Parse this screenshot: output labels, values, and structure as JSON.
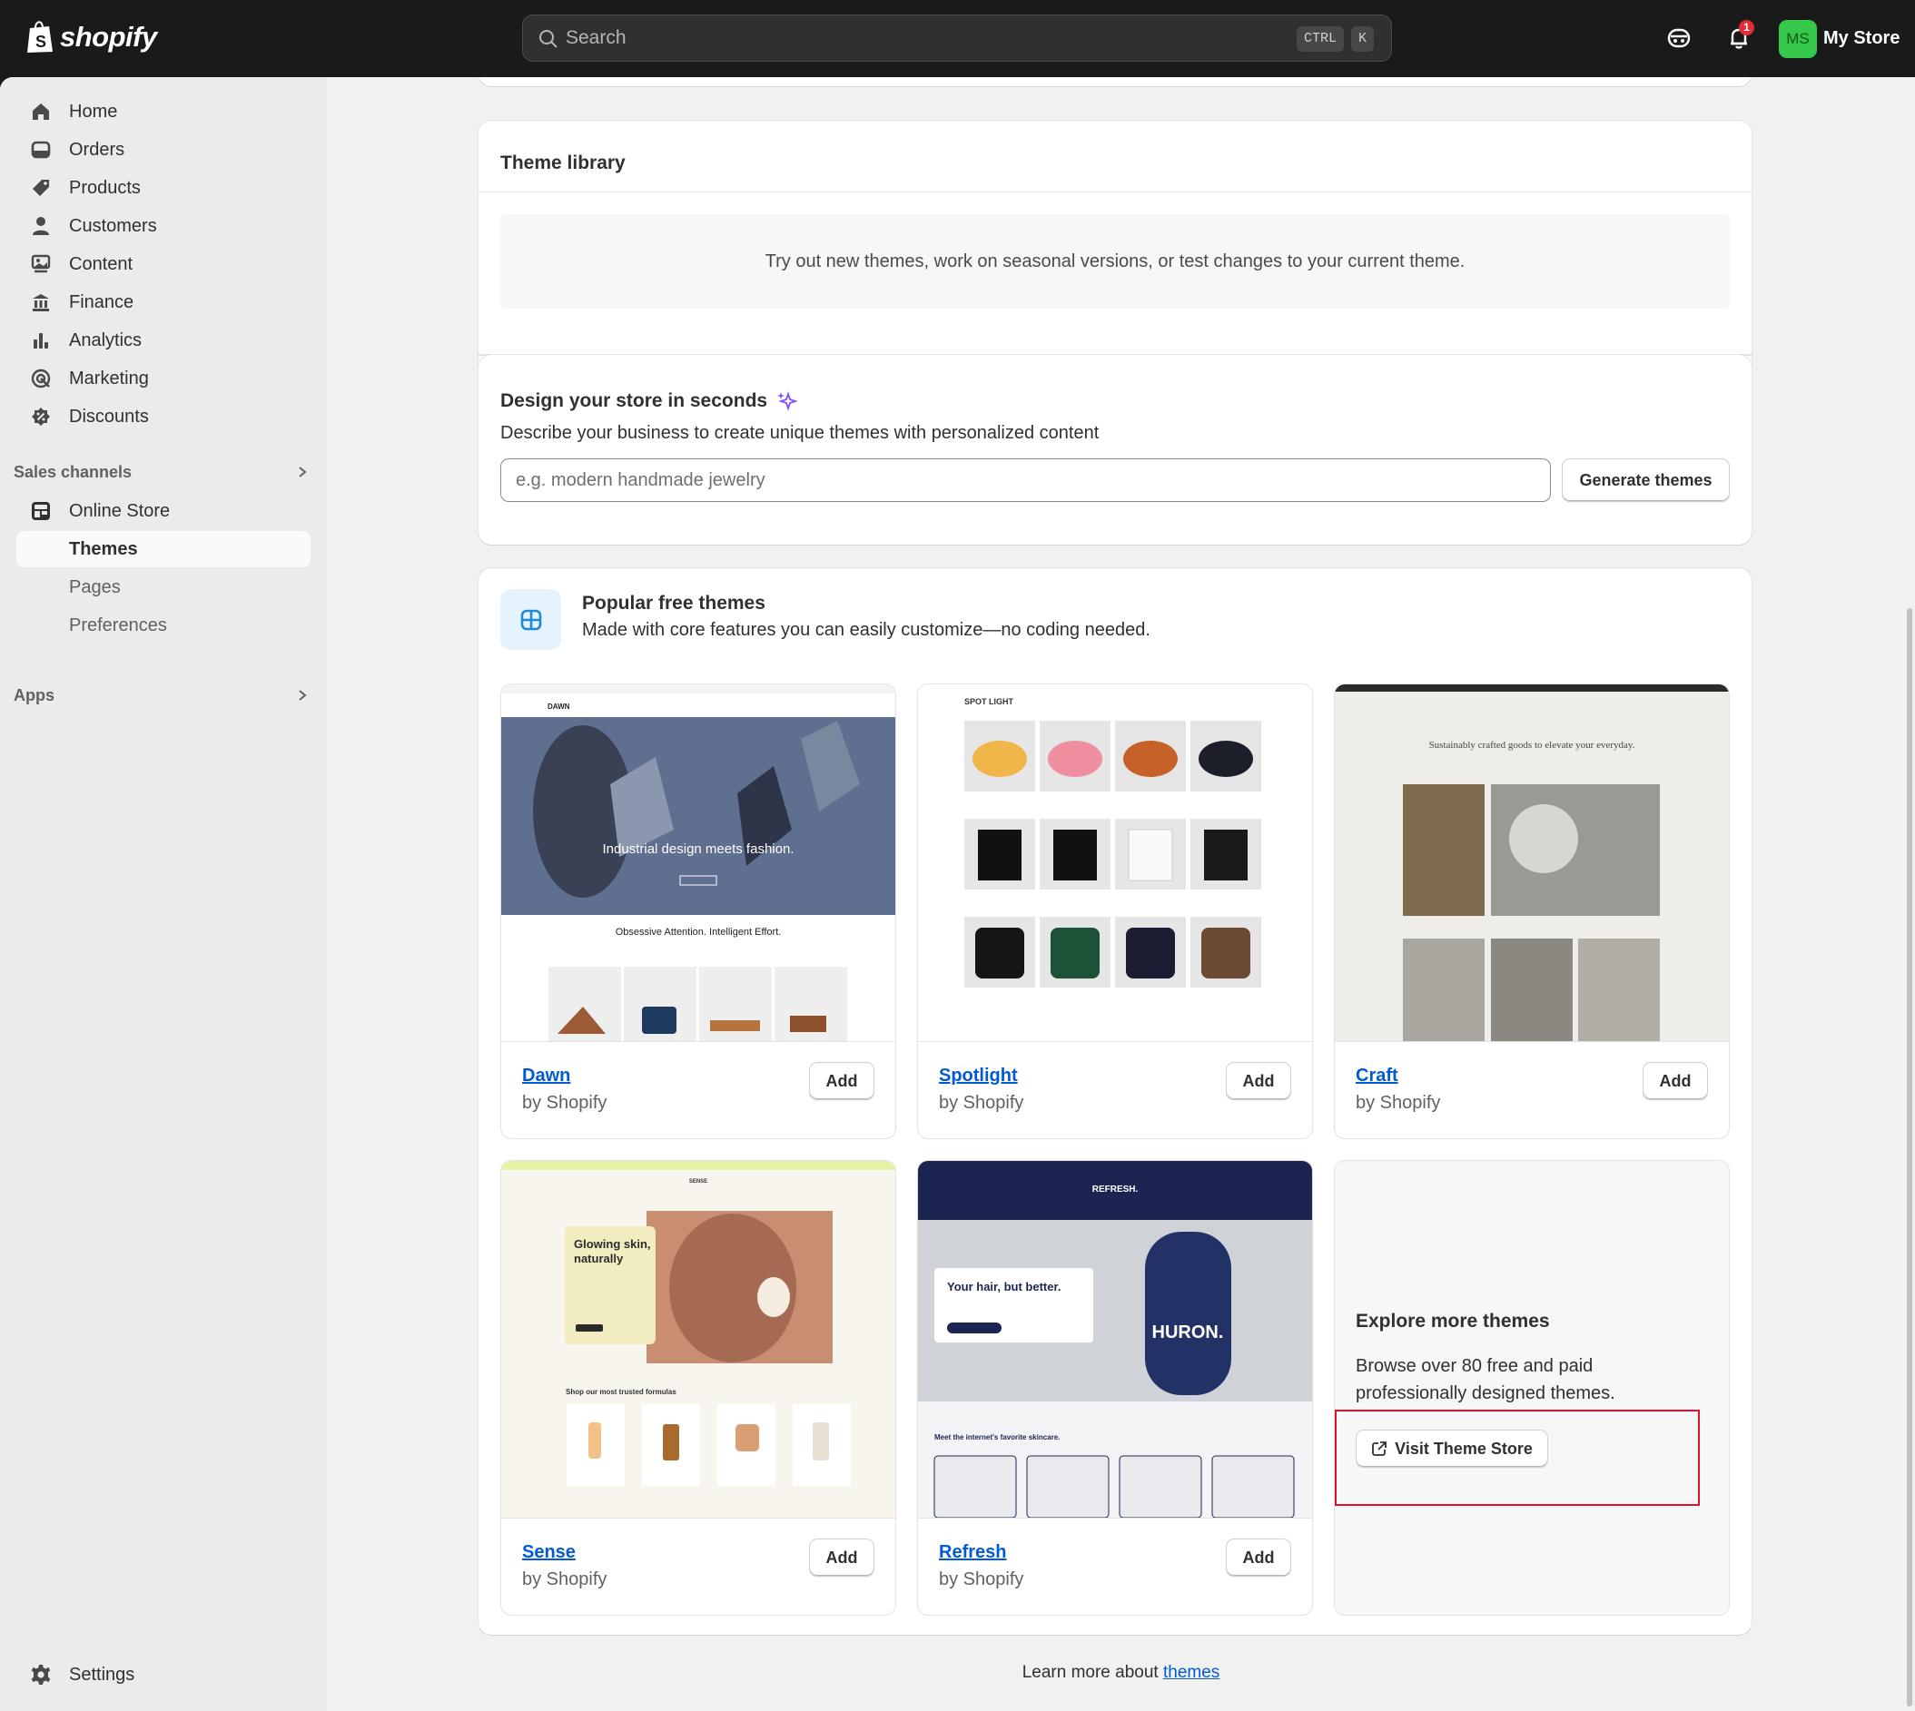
{
  "topbar": {
    "brand": "shopify",
    "search_placeholder": "Search",
    "shortcut_ctrl": "CTRL",
    "shortcut_key": "K",
    "notification_count": "1",
    "avatar_initials": "MS",
    "store_name": "My Store"
  },
  "sidebar": {
    "items": [
      {
        "label": "Home",
        "icon": "home-icon"
      },
      {
        "label": "Orders",
        "icon": "orders-icon"
      },
      {
        "label": "Products",
        "icon": "tag-icon"
      },
      {
        "label": "Customers",
        "icon": "person-icon"
      },
      {
        "label": "Content",
        "icon": "content-icon"
      },
      {
        "label": "Finance",
        "icon": "bank-icon"
      },
      {
        "label": "Analytics",
        "icon": "bar-chart-icon"
      },
      {
        "label": "Marketing",
        "icon": "target-icon"
      },
      {
        "label": "Discounts",
        "icon": "discount-icon"
      }
    ],
    "sales_channels_label": "Sales channels",
    "online_store_label": "Online Store",
    "sub_items": [
      {
        "label": "Themes",
        "active": true
      },
      {
        "label": "Pages"
      },
      {
        "label": "Preferences"
      }
    ],
    "apps_label": "Apps",
    "settings_label": "Settings"
  },
  "theme_library": {
    "title": "Theme library",
    "empty_text": "Try out new themes, work on seasonal versions, or test changes to your current theme."
  },
  "design": {
    "title": "Design your store in seconds",
    "subtitle": "Describe your business to create unique themes with personalized content",
    "input_placeholder": "e.g. modern handmade jewelry",
    "button_label": "Generate themes"
  },
  "popular": {
    "title": "Popular free themes",
    "subtitle": "Made with core features you can easily customize—no coding needed.",
    "add_label": "Add",
    "themes": [
      {
        "name": "Dawn",
        "by": "by Shopify",
        "thumb_text": "Industrial design meets fashion.",
        "thumb_text2": "Obsessive Attention. Intelligent Effort.",
        "brand": "DAWN"
      },
      {
        "name": "Spotlight",
        "by": "by Shopify",
        "brand": "SPOT LIGHT"
      },
      {
        "name": "Craft",
        "by": "by Shopify",
        "thumb_text": "Sustainably crafted goods to elevate your everyday."
      },
      {
        "name": "Sense",
        "by": "by Shopify",
        "thumb_text": "Glowing skin, naturally",
        "thumb_text2": "Shop our most trusted formulas",
        "brand": "SENSE"
      },
      {
        "name": "Refresh",
        "by": "by Shopify",
        "thumb_text": "Your hair, but better.",
        "thumb_text2": "Meet the internet's favorite skincare.",
        "brand": "REFRESH.",
        "product": "HURON."
      }
    ],
    "explore": {
      "title": "Explore more themes",
      "text": "Browse over 80 free and paid professionally designed themes.",
      "button_label": "Visit Theme Store"
    }
  },
  "footer": {
    "learn_prefix": "Learn more about ",
    "learn_link": "themes"
  },
  "colors": {
    "link": "#005bd3",
    "highlight": "#e0102c",
    "avatar": "#36c84a"
  }
}
